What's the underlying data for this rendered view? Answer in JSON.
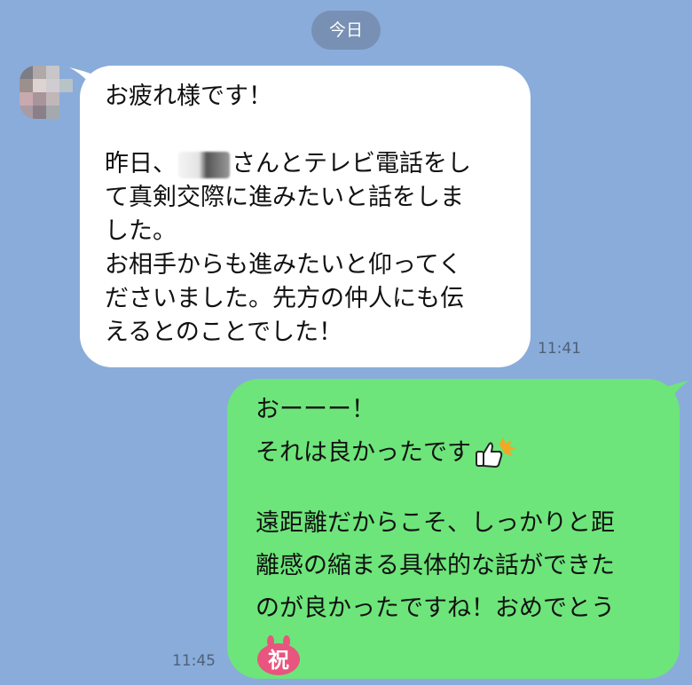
{
  "chat": {
    "date_label": "今日",
    "incoming": {
      "time": "11:41",
      "lines": [
        "お疲れ様です！",
        "",
        "昨日、",
        "さんとテレビ電話をし",
        "て真剣交際に進みたいと話をしま",
        "した。",
        "お相手からも進みたいと仰ってく",
        "ださいました。先方の仲人にも伝",
        "えるとのことでした！"
      ]
    },
    "outgoing": {
      "time": "11:45",
      "lines": [
        "おーーー！",
        "それは良かったです",
        "",
        "遠距離だからこそ、しっかりと距",
        "離感の縮まる具体的な話ができた",
        "のが良かったですね！おめでとう"
      ],
      "celebrate_label": "祝"
    }
  },
  "colors": {
    "background": "#8AACDA",
    "incoming_bubble": "#FFFFFF",
    "outgoing_bubble": "#6DE57A",
    "date_pill": "#7890B4",
    "time_text": "#4E6078"
  },
  "icons": {
    "avatar": "blurred-avatar-icon",
    "thumbs_up": "thumbs-up-sticker-icon",
    "celebrate": "celebration-stamp-icon"
  }
}
